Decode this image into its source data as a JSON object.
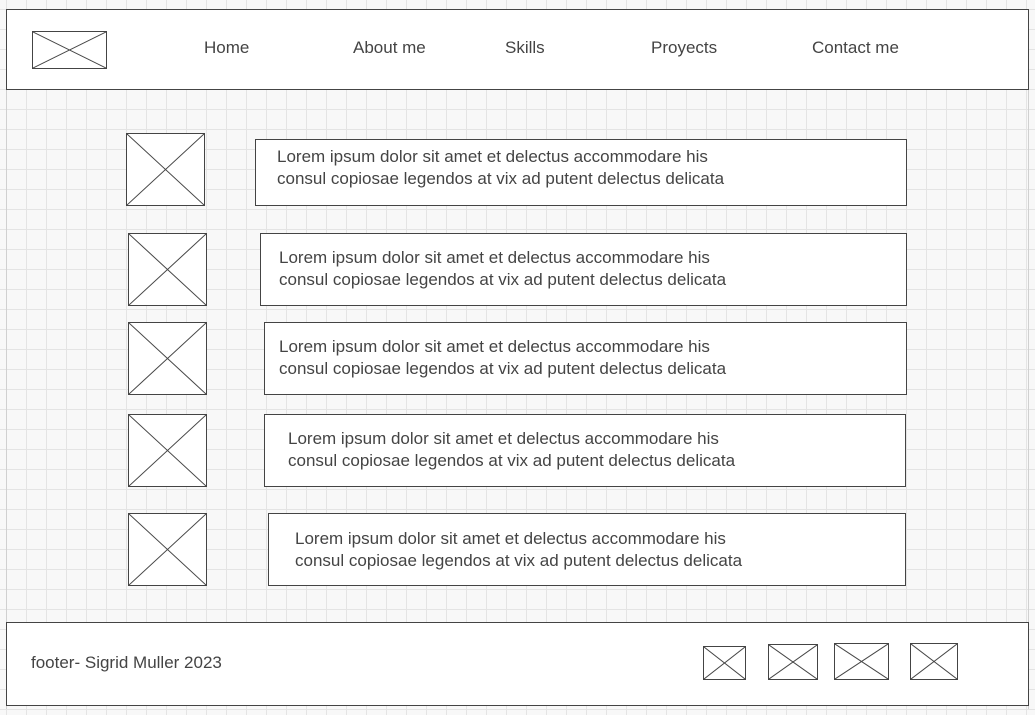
{
  "header": {
    "nav": [
      {
        "label": "Home"
      },
      {
        "label": "About me"
      },
      {
        "label": "Skills"
      },
      {
        "label": "Proyects"
      },
      {
        "label": "Contact me"
      }
    ]
  },
  "content": {
    "items": [
      {
        "line1": "Lorem ipsum dolor sit amet et delectus accommodare his",
        "line2": "consul copiosae legendos at vix ad putent delectus delicata"
      },
      {
        "line1": "Lorem ipsum dolor sit amet et delectus accommodare his",
        "line2": "consul copiosae legendos at vix ad putent delectus delicata"
      },
      {
        "line1": "Lorem ipsum dolor sit amet et delectus accommodare his",
        "line2": "consul copiosae legendos at vix ad putent delectus delicata"
      },
      {
        "line1": "Lorem ipsum dolor sit amet et delectus accommodare his",
        "line2": "consul copiosae legendos at vix ad putent delectus delicata"
      },
      {
        "line1": "Lorem ipsum dolor sit amet et delectus accommodare his",
        "line2": "consul copiosae legendos at vix ad putent delectus delicata"
      }
    ]
  },
  "footer": {
    "text": "footer- Sigrid Muller 2023"
  },
  "colors": {
    "stroke": "#444444",
    "grid": "#e4e4e4",
    "background": "#f8f8f8"
  },
  "icons": {
    "placeholder": "image-placeholder-icon"
  }
}
